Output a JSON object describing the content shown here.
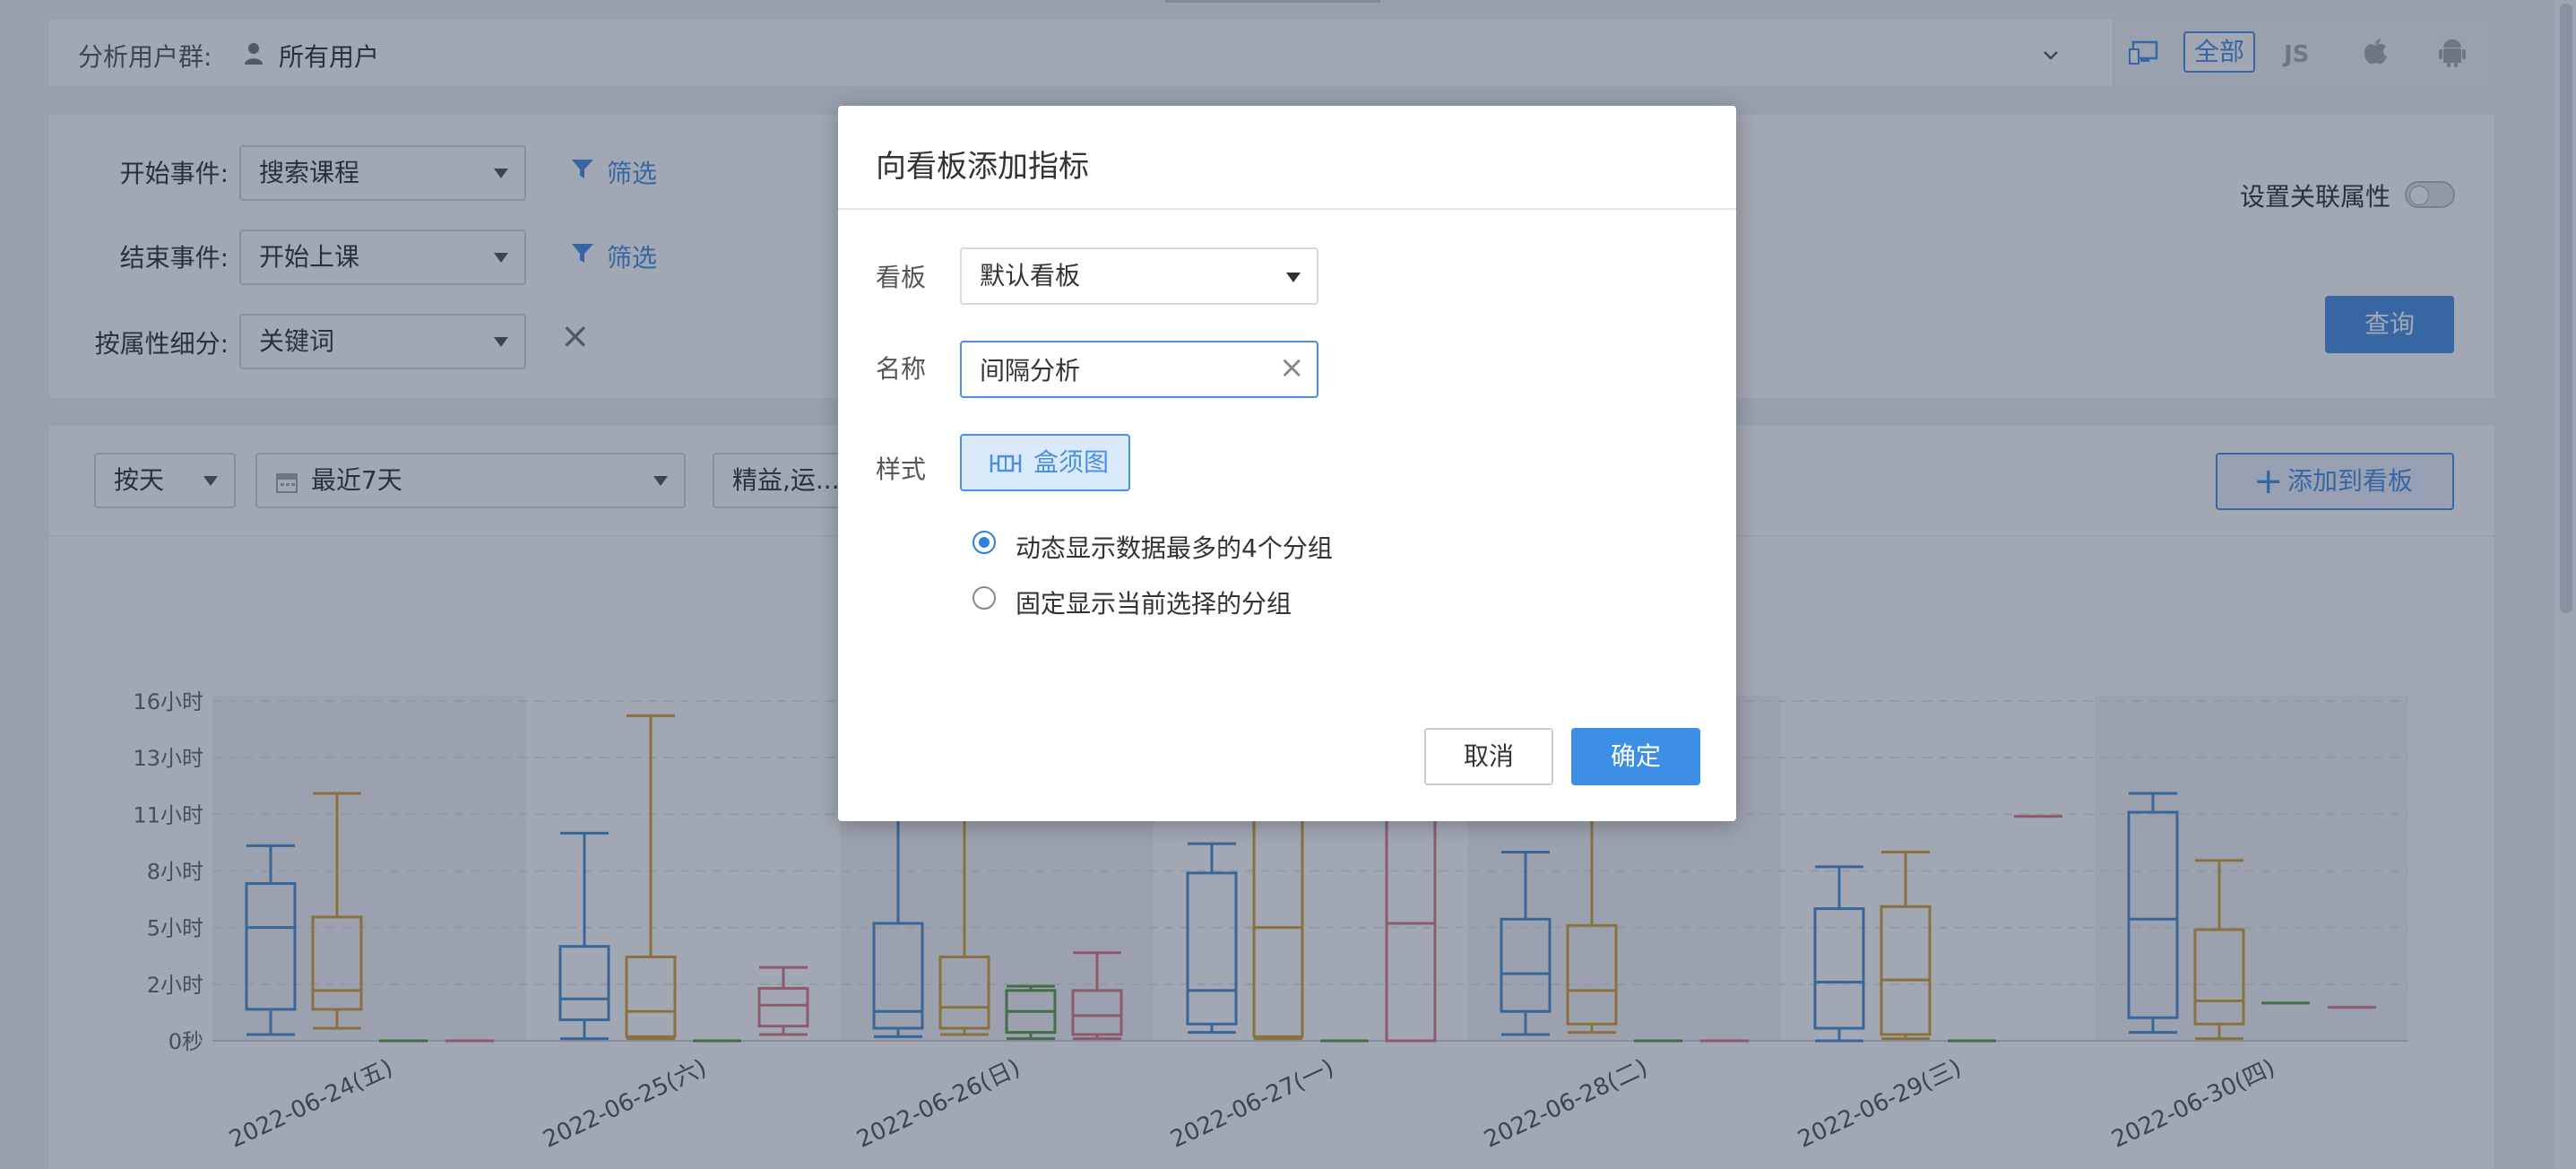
{
  "topbar": {
    "label": "分析用户群:",
    "user_value": "所有用户",
    "platform_all": "全部"
  },
  "filters": {
    "start_label": "开始事件:",
    "start_value": "搜索课程",
    "end_label": "结束事件:",
    "end_value": "开始上课",
    "prop_label": "按属性细分:",
    "prop_value": "关键词",
    "filter_label": "筛选",
    "assoc_label": "设置关联属性",
    "query_label": "查询"
  },
  "toolbar": {
    "granularity": "按天",
    "date_range": "最近7天",
    "group_select": "精益,运...",
    "add_to_board": "添加到看板"
  },
  "chart_data": {
    "type": "boxplot",
    "categories": [
      "2022-06-24(五)",
      "2022-06-25(六)",
      "2022-06-26(日)",
      "2022-06-27(一)",
      "2022-06-28(二)",
      "2022-06-29(三)",
      "2022-06-30(四)"
    ],
    "y_tick_labels": [
      "0秒",
      "2小时",
      "5小时",
      "8小时",
      "11小时",
      "13小时",
      "16小时"
    ],
    "y_ticks": [
      0,
      2.7,
      5.4,
      8.1,
      10.8,
      13.5,
      16.2
    ],
    "ylim": [
      0,
      16.2
    ],
    "series_colors": [
      "#4a90d0",
      "#d6a437",
      "#5e9e45",
      "#dc7d86"
    ],
    "groups": [
      [
        {
          "min": 0.3,
          "q1": 1.5,
          "med": 5.4,
          "q3": 7.5,
          "max": 9.3
        },
        {
          "min": 0.6,
          "q1": 1.5,
          "med": 2.4,
          "q3": 5.9,
          "max": 11.8
        },
        {
          "min": 0,
          "q1": 0,
          "med": 0,
          "q3": 0,
          "max": 0
        },
        {
          "min": 0,
          "q1": 0,
          "med": 0,
          "q3": 0,
          "max": 0
        }
      ],
      [
        {
          "min": 0.1,
          "q1": 1.0,
          "med": 2.0,
          "q3": 4.5,
          "max": 9.9
        },
        {
          "min": 0.1,
          "q1": 0.2,
          "med": 1.4,
          "q3": 4.0,
          "max": 15.5
        },
        {
          "min": 0,
          "q1": 0,
          "med": 0,
          "q3": 0,
          "max": 0
        },
        {
          "min": 0.3,
          "q1": 0.7,
          "med": 1.7,
          "q3": 2.5,
          "max": 3.5
        }
      ],
      [
        {
          "min": 0.2,
          "q1": 0.6,
          "med": 1.4,
          "q3": 5.6,
          "max": 10.6
        },
        {
          "min": 0.3,
          "q1": 0.6,
          "med": 1.6,
          "q3": 4.0,
          "max": 10.6
        },
        {
          "min": 0.1,
          "q1": 0.4,
          "med": 1.4,
          "q3": 2.4,
          "max": 2.6
        },
        {
          "min": 0.1,
          "q1": 0.3,
          "med": 1.2,
          "q3": 2.4,
          "max": 4.2
        }
      ],
      [
        {
          "min": 0.4,
          "q1": 0.8,
          "med": 2.4,
          "q3": 8.0,
          "max": 9.4
        },
        {
          "min": 0.1,
          "q1": 0.2,
          "med": 5.4,
          "q3": 10.6,
          "max": 10.6
        },
        {
          "min": 0,
          "q1": 0,
          "med": 0,
          "q3": 0,
          "max": 0
        },
        {
          "min": 0,
          "q1": 0,
          "med": 5.6,
          "q3": 10.6,
          "max": 10.6
        }
      ],
      [
        {
          "min": 0.3,
          "q1": 1.4,
          "med": 3.2,
          "q3": 5.8,
          "max": 9.0
        },
        {
          "min": 0.4,
          "q1": 0.8,
          "med": 2.4,
          "q3": 5.5,
          "max": 10.6
        },
        {
          "min": 0,
          "q1": 0,
          "med": 0,
          "q3": 0,
          "max": 0
        },
        {
          "min": 0,
          "q1": 0,
          "med": 0,
          "q3": 0,
          "max": 0
        }
      ],
      [
        {
          "min": 0,
          "q1": 0.6,
          "med": 2.8,
          "q3": 6.3,
          "max": 8.3
        },
        {
          "min": 0.1,
          "q1": 0.3,
          "med": 2.9,
          "q3": 6.4,
          "max": 9.0
        },
        {
          "min": 0,
          "q1": 0,
          "med": 0,
          "q3": 0,
          "max": 0
        },
        {
          "min": 10.7,
          "q1": 10.7,
          "med": 10.7,
          "q3": 10.7,
          "max": 10.7
        }
      ],
      [
        {
          "min": 0.4,
          "q1": 1.1,
          "med": 5.8,
          "q3": 10.9,
          "max": 11.8
        },
        {
          "min": 0.1,
          "q1": 0.8,
          "med": 1.9,
          "q3": 5.3,
          "max": 8.6
        },
        {
          "min": 1.8,
          "q1": 1.8,
          "med": 1.8,
          "q3": 1.8,
          "max": 1.8
        },
        {
          "min": 1.6,
          "q1": 1.6,
          "med": 1.6,
          "q3": 1.6,
          "max": 1.6
        }
      ]
    ]
  },
  "modal": {
    "title": "向看板添加指标",
    "board_label": "看板",
    "board_value": "默认看板",
    "name_label": "名称",
    "name_value": "间隔分析",
    "style_label": "样式",
    "style_value": "盒须图",
    "radio1": "动态显示数据最多的4个分组",
    "radio2": "固定显示当前选择的分组",
    "cancel": "取消",
    "ok": "确定"
  }
}
